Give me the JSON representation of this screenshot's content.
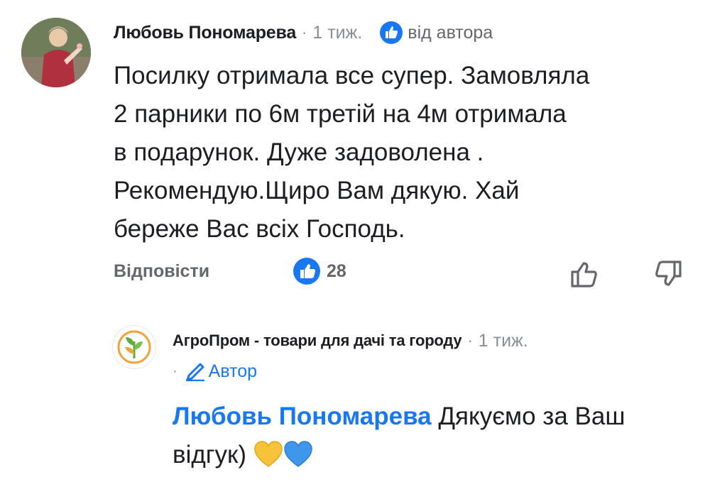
{
  "comment": {
    "author": "Любовь Пономарева",
    "time": "1 тиж.",
    "author_badge": "від автора",
    "text": "Посилку отримала все супер. Замовляла\n2 парники по 6м  третій на 4м отримала\nв подарунок. Дуже задоволена .\nРекомендую.Щиро Вам дякую.  Хай\nбереже Вас всіх Господь.",
    "reply_label": "Відповісти",
    "likes": "28",
    "icons": [
      "like-reaction-icon",
      "thumb-up-outline-icon",
      "thumb-down-outline-icon"
    ]
  },
  "reply": {
    "author": "АгроПром - товари для дачі та городу",
    "time": "1 тиж.",
    "badge": "Автор",
    "mention": "Любовь Пономарева",
    "text": " Дякуємо за Ваш відгук) ",
    "hearts": [
      "yellow-heart",
      "blue-heart"
    ],
    "icons": [
      "agroprom-logo-icon",
      "pencil-icon"
    ]
  },
  "colors": {
    "accent": "#1877f2",
    "secondary_text": "#65676b",
    "meta_text": "#8a8d91",
    "yellow_heart": "#f7c33a",
    "blue_heart": "#3e97ea"
  }
}
